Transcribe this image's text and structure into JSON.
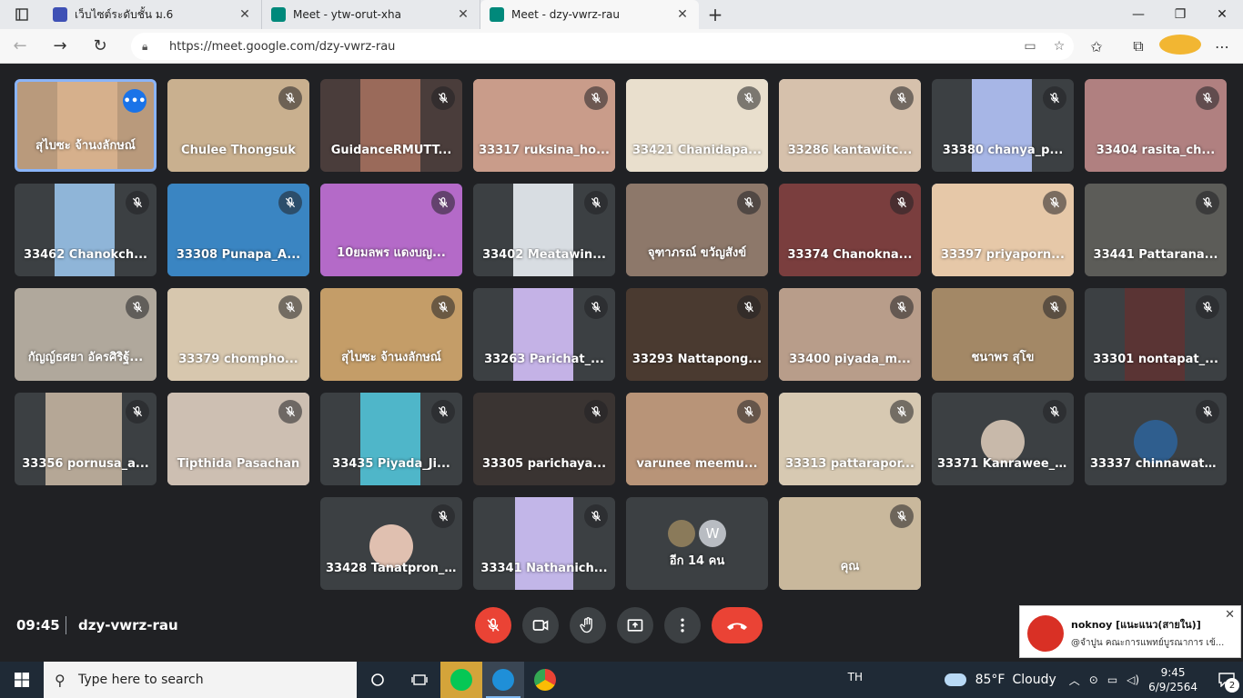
{
  "browser": {
    "tabs": [
      {
        "label": "เว็บไซต์ระดับชั้น ม.6",
        "fav_color": "#3f51b5"
      },
      {
        "label": "Meet - ytw-orut-xha",
        "fav_color": "#00897b"
      },
      {
        "label": "Meet - dzy-vwrz-rau",
        "fav_color": "#00897b",
        "active": true
      }
    ],
    "url": "https://meet.google.com/dzy-vwrz-rau"
  },
  "participants": [
    {
      "name": "สุไบซะ จ้านงลักษณ์",
      "bg": "#b99a7c",
      "vbg": "#d6b08c",
      "vleft": 44,
      "vwidth": 66,
      "active": true
    },
    {
      "name": "Chulee Thongsuk",
      "bg": "#8d9a7a",
      "vbg": "#c9b08f",
      "vleft": 0,
      "vwidth": 156
    },
    {
      "name": "GuidanceRMUTT...",
      "bg": "#4a3d3b",
      "vbg": "#9a6a5a",
      "vleft": 44,
      "vwidth": 66
    },
    {
      "name": "33317 ruksina_ho...",
      "bg": "#d8b7a7",
      "vbg": "#c99c8a",
      "vleft": 0,
      "vwidth": 156
    },
    {
      "name": "33421 Chanidapa...",
      "bg": "#9fd7e6",
      "vbg": "#e9dfcd",
      "vleft": 0,
      "vwidth": 156
    },
    {
      "name": "33286 kantawitc...",
      "bg": "#dfe4ea",
      "vbg": "#d6c1ac",
      "vleft": 0,
      "vwidth": 156
    },
    {
      "name": "33380 chanya_p...",
      "bg": "#3c4043",
      "vbg": "#a7b6e6",
      "vleft": 44,
      "vwidth": 66
    },
    {
      "name": "33404 rasita_ch...",
      "bg": "#6d4a4a",
      "vbg": "#b08080",
      "vleft": 0,
      "vwidth": 156
    },
    {
      "name": "33462 Chanokch...",
      "bg": "#3c4043",
      "vbg": "#8fb5d8",
      "vleft": 44,
      "vwidth": 66
    },
    {
      "name": "33308 Punapa_A...",
      "bg": "#2f6fa8",
      "vbg": "#3a85c2",
      "vleft": 0,
      "vwidth": 156
    },
    {
      "name": "10ยมลพร แดงบญ...",
      "bg": "#6b5fd3",
      "vbg": "#b46ac8",
      "vleft": 0,
      "vwidth": 156
    },
    {
      "name": "33402 Meatawin...",
      "bg": "#3c4043",
      "vbg": "#d8dde2",
      "vleft": 44,
      "vwidth": 66
    },
    {
      "name": "จุฑาภรณ์ ขวัญสังข์",
      "bg": "#6a5a52",
      "vbg": "#8d786a",
      "vleft": 0,
      "vwidth": 156
    },
    {
      "name": "33374 Chanokna...",
      "bg": "#4d3434",
      "vbg": "#7a3e3e",
      "vleft": 0,
      "vwidth": 156
    },
    {
      "name": "33397 priyaporn...",
      "bg": "#cfe2ec",
      "vbg": "#e6c8a8",
      "vleft": 0,
      "vwidth": 156
    },
    {
      "name": "33441 Pattarana...",
      "bg": "#4a4a48",
      "vbg": "#5c5c58",
      "vleft": 0,
      "vwidth": 156
    },
    {
      "name": "กัญญ์ธศยา อัครศิริฐ้...",
      "bg": "#7d7872",
      "vbg": "#b0a89c",
      "vleft": 0,
      "vwidth": 156
    },
    {
      "name": "33379 chompho...",
      "bg": "#e8e2d8",
      "vbg": "#d7c7ae",
      "vleft": 0,
      "vwidth": 156
    },
    {
      "name": "สุไบซะ จ้านงลักษณ์",
      "bg": "#4c5a3e",
      "vbg": "#c49d68",
      "vleft": 0,
      "vwidth": 156
    },
    {
      "name": "33263 Parichat_...",
      "bg": "#3c4043",
      "vbg": "#c4b2e6",
      "vleft": 44,
      "vwidth": 66
    },
    {
      "name": "33293 Nattapong...",
      "bg": "#2d2a28",
      "vbg": "#4a3a30",
      "vleft": 0,
      "vwidth": 156
    },
    {
      "name": "33400 piyada_m...",
      "bg": "#c9c4bf",
      "vbg": "#b89d8a",
      "vleft": 0,
      "vwidth": 156
    },
    {
      "name": "ชนาพร สุโข",
      "bg": "#7a6d5e",
      "vbg": "#a38866",
      "vleft": 0,
      "vwidth": 156
    },
    {
      "name": "33301 nontapat_...",
      "bg": "#3c4043",
      "vbg": "#5a3434",
      "vleft": 44,
      "vwidth": 66
    },
    {
      "name": "33356 pornusa_a...",
      "bg": "#3c4043",
      "vbg": "#b5a796",
      "vleft": 34,
      "vwidth": 84
    },
    {
      "name": "Tipthida Pasachan",
      "bg": "#d9cfc6",
      "vbg": "#cdbfb2",
      "vleft": 0,
      "vwidth": 156
    },
    {
      "name": "33435 Piyada_Ji...",
      "bg": "#3c4043",
      "vbg": "#4fb6c9",
      "vleft": 44,
      "vwidth": 66
    },
    {
      "name": "33305 parichaya...",
      "bg": "#1e1c1c",
      "vbg": "#3a3432",
      "vleft": 0,
      "vwidth": 156
    },
    {
      "name": "varunee meemu...",
      "bg": "#d0a35e",
      "vbg": "#b89478",
      "vleft": 0,
      "vwidth": 156
    },
    {
      "name": "33313 pattarapor...",
      "bg": "#bcd5e9",
      "vbg": "#d7c9b2",
      "vleft": 0,
      "vwidth": 156
    },
    {
      "name": "33371 Kanrawee_T...",
      "bg": "#3c4043",
      "avatar": "#c8b9aa"
    },
    {
      "name": "33337 chinnawat_...",
      "bg": "#3c4043",
      "avatar": "#2f5e8e"
    },
    {
      "name": "33428 Tanatpron_...",
      "bg": "#3c4043",
      "avatar": "#e0c0b0"
    },
    {
      "name": "33341 Nathanich...",
      "bg": "#3c4043",
      "vbg": "#c2b6e8",
      "vleft": 46,
      "vwidth": 64
    },
    {
      "name": "อีก 14 คน",
      "bg": "#3c4043",
      "others": true,
      "other_letter": "W"
    },
    {
      "name": "คุณ",
      "bg": "#d8cfc4",
      "vbg": "#c9b89c",
      "vleft": 0,
      "vwidth": 156
    }
  ],
  "meeting": {
    "time": "09:45",
    "code": "dzy-vwrz-rau"
  },
  "notification": {
    "title": "noknoy [แนะแนว(สายใน)]",
    "message": "@จำปูน คณะการแพทย์บูรณาการ เข้..."
  },
  "taskbar": {
    "search_placeholder": "Type here to search",
    "language": "TH",
    "weather_temp": "85°F",
    "weather_desc": "Cloudy",
    "clock_time": "9:45",
    "clock_date": "6/9/2564",
    "notif_count": "2"
  }
}
